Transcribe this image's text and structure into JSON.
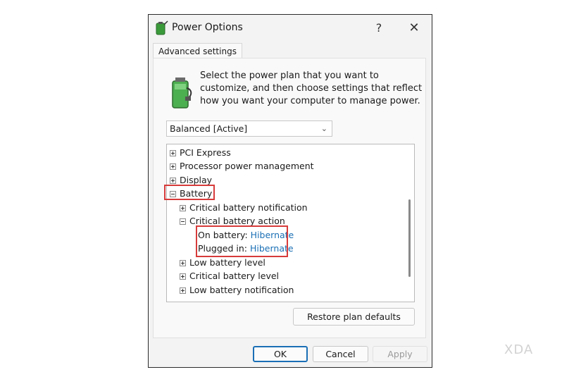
{
  "window": {
    "title": "Power Options",
    "help_label": "?",
    "close_label": "✕"
  },
  "tab": {
    "label": "Advanced settings"
  },
  "description": "Select the power plan that you want to customize, and then choose settings that reflect how you want your computer to manage power.",
  "plan_select": {
    "value": "Balanced [Active]"
  },
  "tree": [
    {
      "label": "PCI Express",
      "state": "collapsed"
    },
    {
      "label": "Processor power management",
      "state": "collapsed"
    },
    {
      "label": "Display",
      "state": "collapsed"
    },
    {
      "label": "Battery",
      "state": "expanded"
    },
    {
      "label": "Critical battery notification",
      "state": "collapsed"
    },
    {
      "label": "Critical battery action",
      "state": "expanded"
    },
    {
      "label": "On battery:",
      "value": "Hibernate"
    },
    {
      "label": "Plugged in:",
      "value": "Hibernate"
    },
    {
      "label": "Low battery level",
      "state": "collapsed"
    },
    {
      "label": "Critical battery level",
      "state": "collapsed"
    },
    {
      "label": "Low battery notification",
      "state": "collapsed"
    }
  ],
  "buttons": {
    "restore": "Restore plan defaults",
    "ok": "OK",
    "cancel": "Cancel",
    "apply": "Apply"
  },
  "colors": {
    "highlight": "#d73b3b",
    "link_value": "#1a6fb5"
  },
  "watermark": "XDA"
}
